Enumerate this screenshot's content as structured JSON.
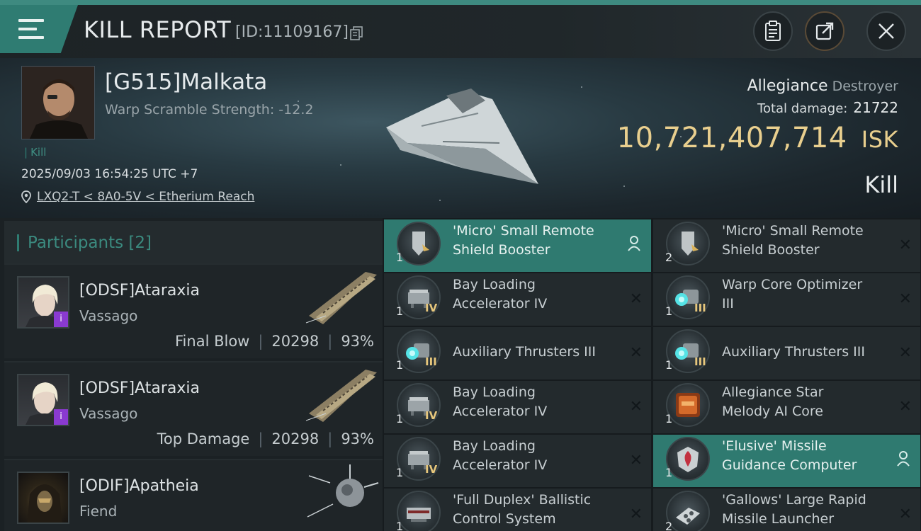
{
  "header": {
    "title": "KILL REPORT",
    "id_text": "[ID:11109167]"
  },
  "victim": {
    "name": "[G515]Malkata",
    "warp_scramble": "Warp Scramble Strength: -12.2",
    "kill_tag": "Kill",
    "timestamp": "2025/09/03 16:54:25 UTC +7",
    "location": "LXQ2-T < 8A0-5V < Etherium Reach",
    "ship_name": "Allegiance",
    "ship_class": "Destroyer",
    "total_damage_label": "Total damage:",
    "total_damage": "21722",
    "isk_value": "10,721,407,714",
    "isk_unit": "ISK",
    "result_label": "Kill"
  },
  "participants": {
    "title": "Participants [2]",
    "rows": [
      {
        "name": "[ODSF]Ataraxia",
        "ship": "Vassago",
        "role": "Final Blow",
        "damage": "20298",
        "percent": "93%"
      },
      {
        "name": "[ODSF]Ataraxia",
        "ship": "Vassago",
        "role": "Top Damage",
        "damage": "20298",
        "percent": "93%"
      },
      {
        "name": "[ODIF]Apatheia",
        "ship": "Fiend"
      }
    ]
  },
  "modules": [
    {
      "qty": "1",
      "tier": "",
      "line1": "'Micro' Small Remote",
      "line2": "Shield Booster",
      "status": "person",
      "icon": "shield-booster-icon"
    },
    {
      "qty": "2",
      "tier": "",
      "line1": "'Micro' Small Remote",
      "line2": "Shield Booster",
      "status": "x",
      "icon": "shield-booster-icon"
    },
    {
      "qty": "1",
      "tier": "IV",
      "line1": "Bay Loading",
      "line2": "Accelerator IV",
      "status": "x",
      "icon": "bay-loader-icon"
    },
    {
      "qty": "1",
      "tier": "III",
      "line1": "Warp Core Optimizer",
      "line2": "III",
      "status": "x",
      "icon": "thruster-icon"
    },
    {
      "qty": "1",
      "tier": "III",
      "line1": "Auxiliary Thrusters III",
      "line2": "",
      "status": "x",
      "icon": "thruster-icon"
    },
    {
      "qty": "1",
      "tier": "III",
      "line1": "Auxiliary Thrusters III",
      "line2": "",
      "status": "x",
      "icon": "thruster-icon"
    },
    {
      "qty": "1",
      "tier": "IV",
      "line1": "Bay Loading",
      "line2": "Accelerator IV",
      "status": "x",
      "icon": "bay-loader-icon"
    },
    {
      "qty": "1",
      "tier": "",
      "line1": "Allegiance Star",
      "line2": "Melody AI Core",
      "status": "x",
      "icon": "ai-core-icon"
    },
    {
      "qty": "1",
      "tier": "IV",
      "line1": "Bay Loading",
      "line2": "Accelerator IV",
      "status": "x",
      "icon": "bay-loader-icon"
    },
    {
      "qty": "1",
      "tier": "",
      "line1": "'Elusive' Missile",
      "line2": "Guidance Computer",
      "status": "person",
      "icon": "guidance-computer-icon"
    },
    {
      "qty": "1",
      "tier": "",
      "line1": "'Full Duplex' Ballistic",
      "line2": "Control System",
      "status": "x",
      "icon": "ballistic-control-icon"
    },
    {
      "qty": "2",
      "tier": "",
      "line1": "'Gallows' Large Rapid",
      "line2": "Missile Launcher",
      "status": "x",
      "icon": "missile-launcher-icon"
    }
  ],
  "colors": {
    "accent_teal": "#2f7c72",
    "isk_gold": "#e9cf8e",
    "highlight_row": "#2f7a70",
    "badge_purple": "#8a3ad1"
  }
}
